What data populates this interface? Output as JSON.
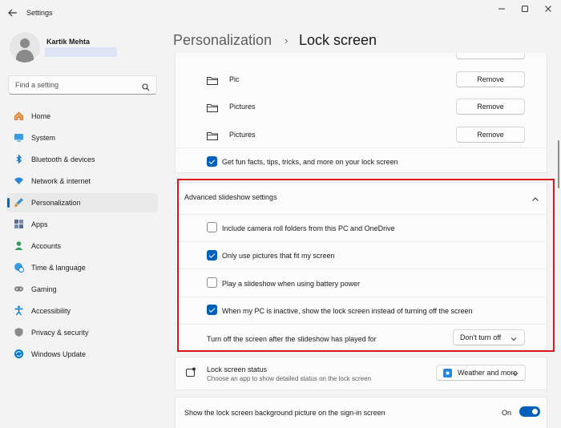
{
  "window": {
    "title": "Settings",
    "back_icon": "back-arrow-icon",
    "controls": [
      "minimize-icon",
      "maximize-icon",
      "close-icon"
    ]
  },
  "user": {
    "name": "Kartik Mehta"
  },
  "search": {
    "placeholder": "Find a setting",
    "icon": "search-icon"
  },
  "sidebar": {
    "items": [
      {
        "label": "Home",
        "icon": "home-icon",
        "color": "#d67a2a"
      },
      {
        "label": "System",
        "icon": "monitor-icon",
        "color": "#0078d4"
      },
      {
        "label": "Bluetooth & devices",
        "icon": "bluetooth-icon",
        "color": "#0078d4"
      },
      {
        "label": "Network & internet",
        "icon": "wifi-icon",
        "color": "#0078d4"
      },
      {
        "label": "Personalization",
        "icon": "brush-icon",
        "color": "#e08a3c",
        "selected": true
      },
      {
        "label": "Apps",
        "icon": "apps-icon",
        "color": "#4b5a78"
      },
      {
        "label": "Accounts",
        "icon": "person-icon",
        "color": "#2f9e5e"
      },
      {
        "label": "Time & language",
        "icon": "globe-clock-icon",
        "color": "#0078d4"
      },
      {
        "label": "Gaming",
        "icon": "gamepad-icon",
        "color": "#7a7a7a"
      },
      {
        "label": "Accessibility",
        "icon": "accessibility-icon",
        "color": "#0078d4"
      },
      {
        "label": "Privacy & security",
        "icon": "shield-icon",
        "color": "#6b6b6b"
      },
      {
        "label": "Windows Update",
        "icon": "update-icon",
        "color": "#0078d4"
      }
    ],
    "accent": "#0067c0"
  },
  "header": {
    "parent": "Personalization",
    "separator": "›",
    "current": "Lock screen"
  },
  "folders": [
    {
      "name": "Pic",
      "button": "Remove"
    },
    {
      "name": "Pictures",
      "button": "Remove"
    },
    {
      "name": "Pictures",
      "button": "Remove"
    }
  ],
  "fun_facts": {
    "label": "Get fun facts, tips, tricks, and more on your lock screen",
    "checked": true
  },
  "advanced": {
    "title": "Advanced slideshow settings",
    "options": [
      {
        "label": "Include camera roll folders from this PC and OneDrive",
        "checked": false
      },
      {
        "label": "Only use pictures that fit my screen",
        "checked": true
      },
      {
        "label": "Play a slideshow when using battery power",
        "checked": false
      },
      {
        "label": "When my PC is inactive, show the lock screen instead of turning off the screen",
        "checked": true
      }
    ],
    "turn_off": {
      "label": "Turn off the screen after the slideshow has played for",
      "value": "Don't turn off"
    }
  },
  "lock_status": {
    "title": "Lock screen status",
    "subtitle": "Choose an app to show detailed status on the lock screen",
    "value": "Weather and more"
  },
  "signin_bg": {
    "label": "Show the lock screen background picture on the sign-in screen",
    "state": "On",
    "on": true
  },
  "colors": {
    "accent": "#005fb8",
    "highlight": "#e0151b"
  }
}
